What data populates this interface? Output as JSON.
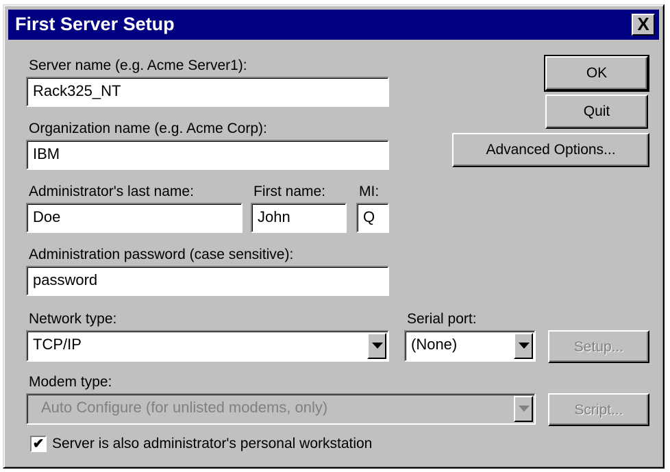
{
  "title": "First Server Setup",
  "close_label": "X",
  "server_name": {
    "label": "Server name (e.g. Acme Server1):",
    "value": "Rack325_NT"
  },
  "org_name": {
    "label": "Organization name (e.g. Acme Corp):",
    "value": "IBM"
  },
  "admin_last": {
    "label": "Administrator's last name:",
    "value": "Doe"
  },
  "first_name": {
    "label": "First name:",
    "value": "John"
  },
  "mi": {
    "label": "MI:",
    "value": "Q"
  },
  "password": {
    "label": "Administration password (case sensitive):",
    "value": "password"
  },
  "network_type": {
    "label": "Network type:",
    "value": "TCP/IP"
  },
  "serial_port": {
    "label": "Serial port:",
    "value": "(None)"
  },
  "modem_type": {
    "label": "Modem type:",
    "value": "Auto Configure (for unlisted modems, only)"
  },
  "checkbox": {
    "label": "Server is also administrator's personal workstation",
    "checked": true,
    "mark": "✔"
  },
  "buttons": {
    "ok": "OK",
    "quit": "Quit",
    "advanced": "Advanced Options...",
    "setup": "Setup...",
    "script": "Script..."
  }
}
